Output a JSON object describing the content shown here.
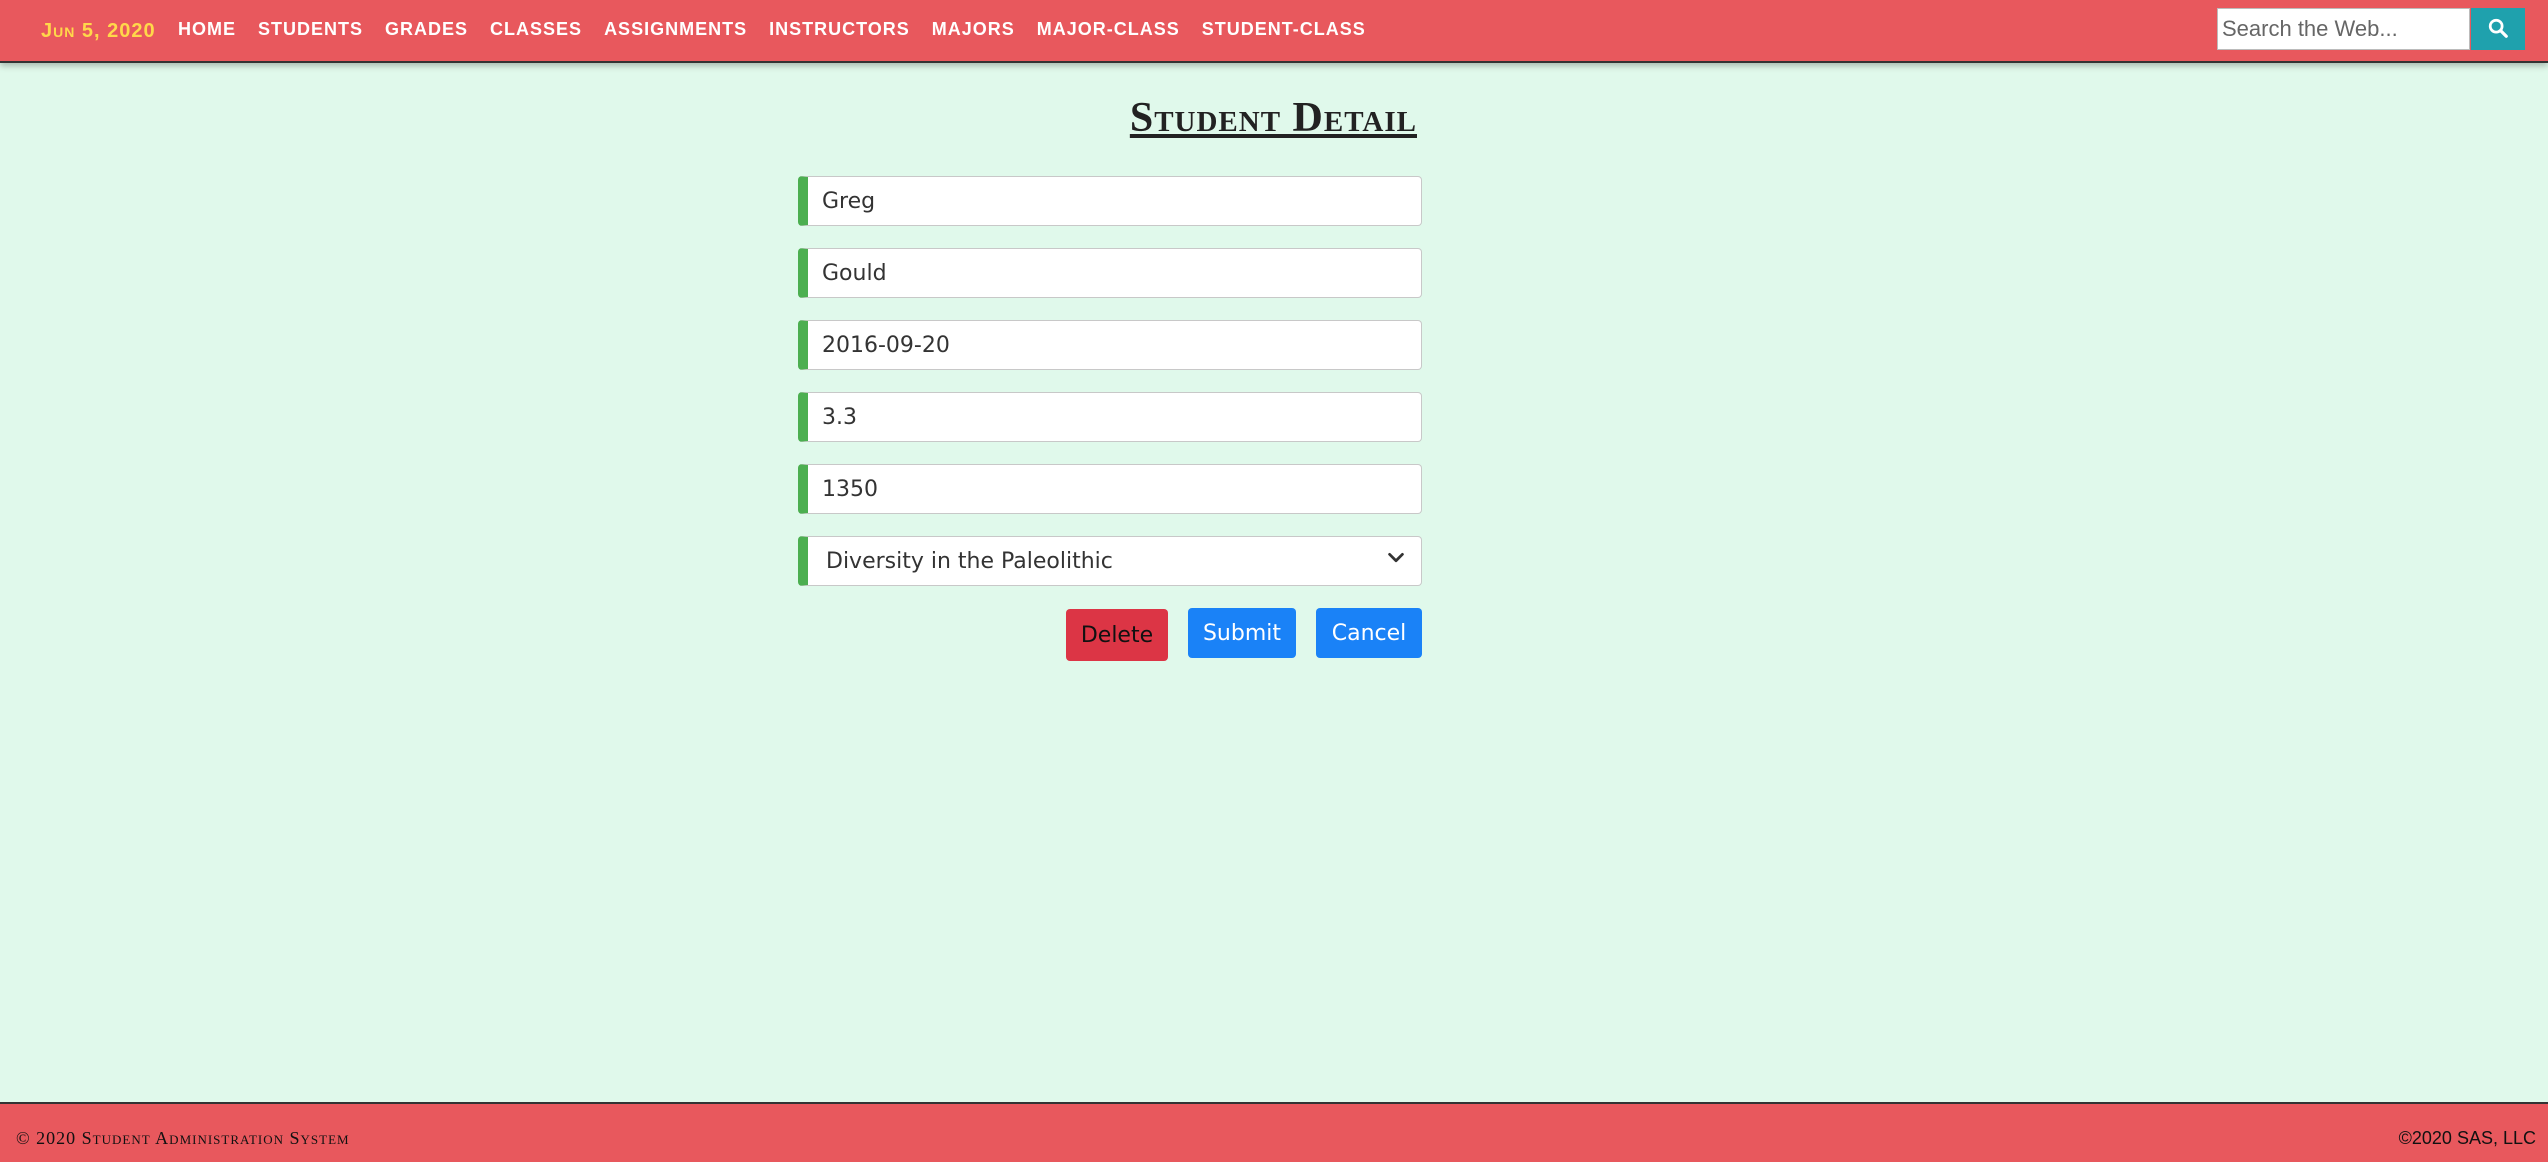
{
  "nav": {
    "date": "Jun 5, 2020",
    "links": [
      "Home",
      "Students",
      "Grades",
      "Classes",
      "Assignments",
      "Instructors",
      "Majors",
      "Major-Class",
      "Student-Class"
    ],
    "search_placeholder": "Search the Web...",
    "search_icon": "search-icon"
  },
  "main": {
    "title": "Student Detail",
    "fields": {
      "first_name": "Greg",
      "last_name": "Gould",
      "date": "2016-09-20",
      "gpa": "3.3",
      "sat": "1350",
      "major_selected": "Diversity in the Paleolithic"
    },
    "buttons": {
      "delete": "Delete",
      "submit": "Submit",
      "cancel": "Cancel"
    }
  },
  "footer": {
    "left": "© 2020 Student Administration System",
    "right": "©2020 SAS, LLC"
  },
  "colors": {
    "nav_bg": "#e8585d",
    "page_bg": "#e0f9eb",
    "field_accent": "#4caf50",
    "delete": "#dc3545",
    "primary": "#1a82f7",
    "search_btn": "#1fa1ad",
    "date_text": "#ffd84a"
  }
}
